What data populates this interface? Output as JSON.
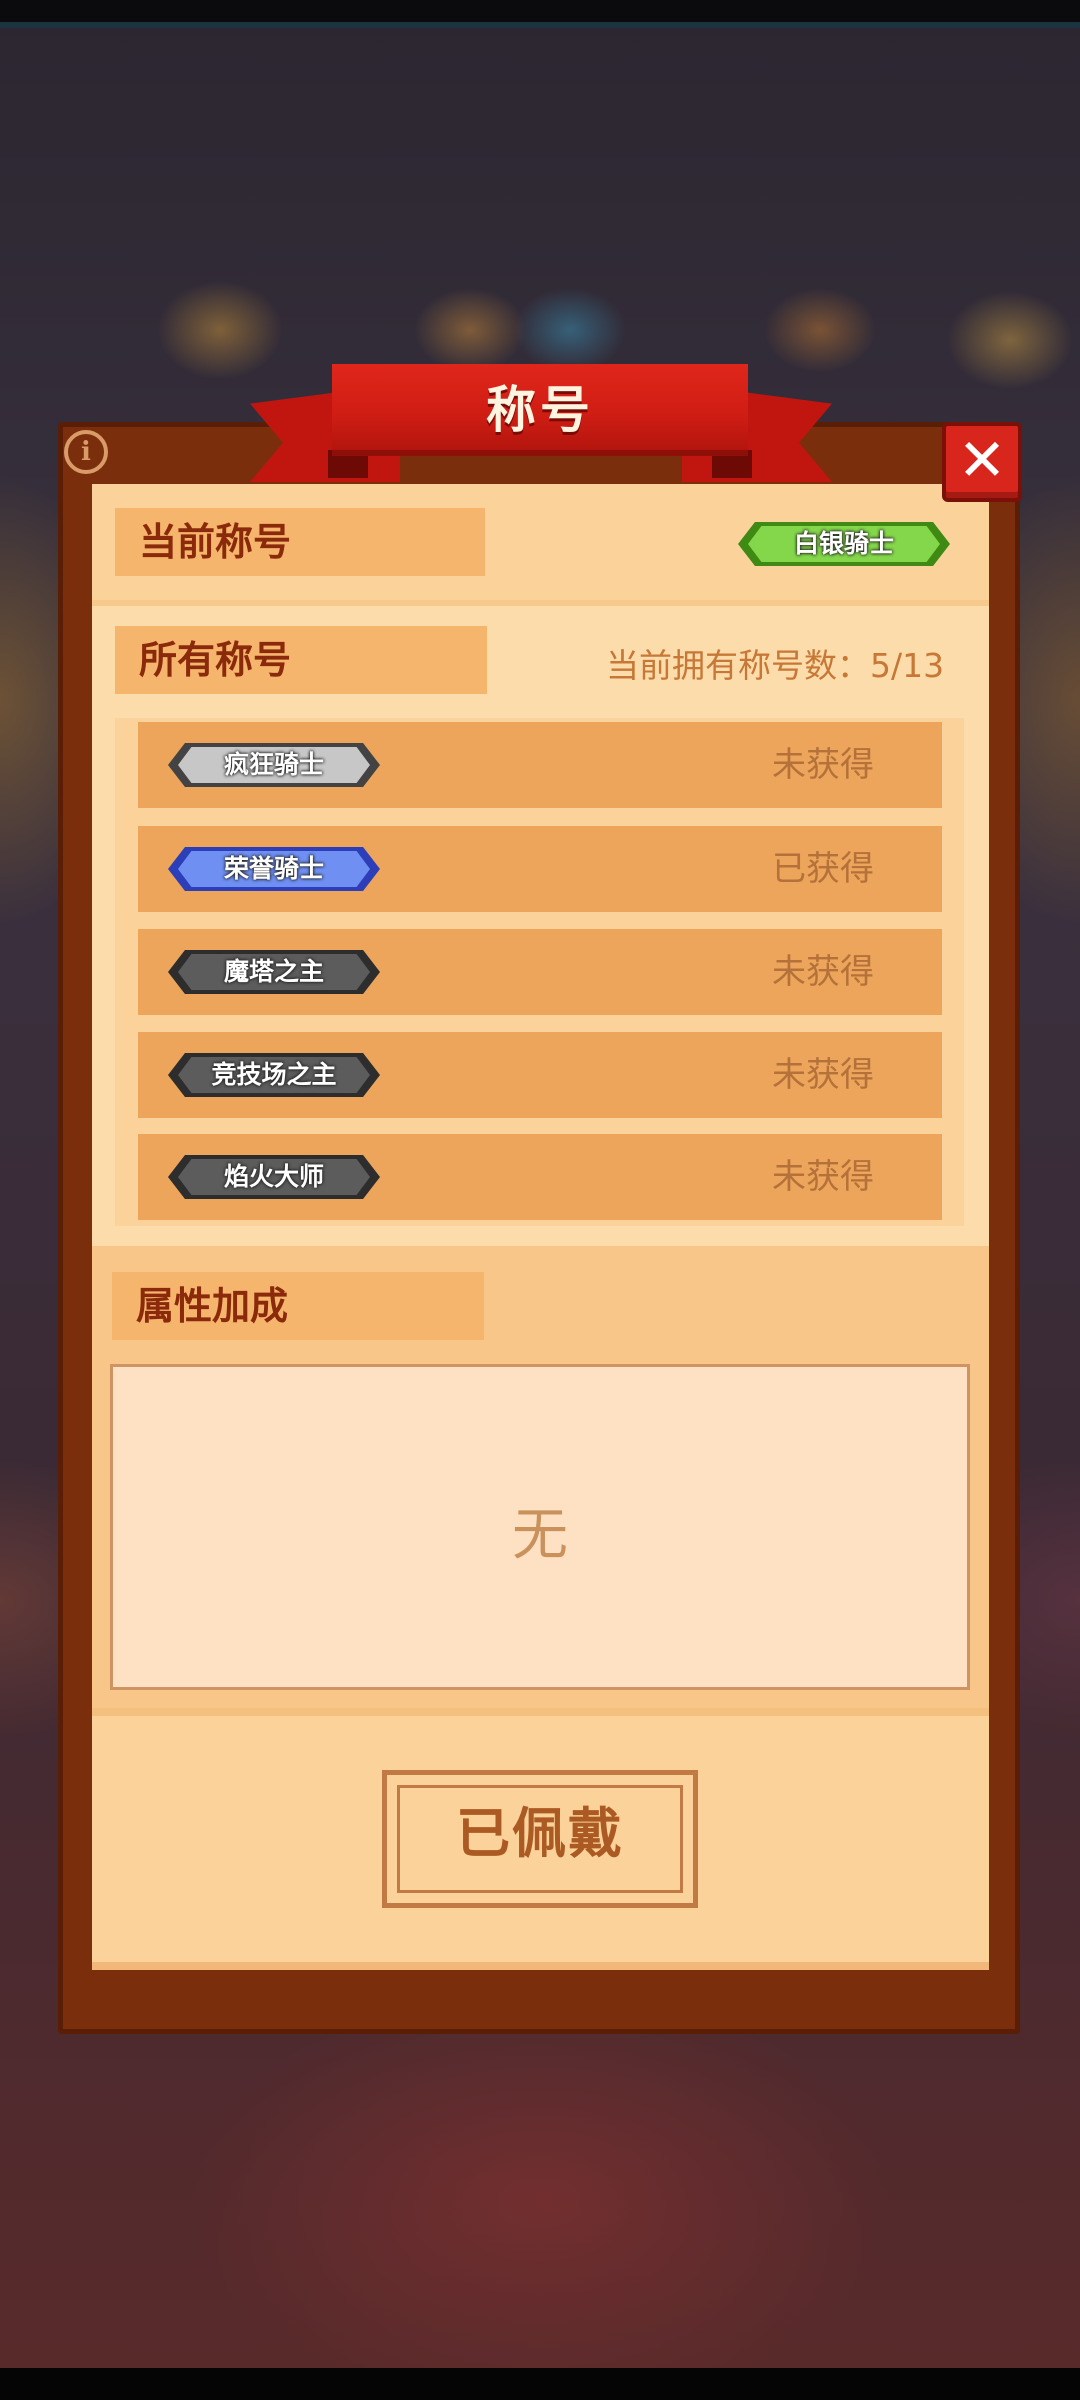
{
  "dialog": {
    "title": "称号",
    "current_title_heading": "当前称号",
    "current_title_badge": "白银骑士",
    "all_titles_heading": "所有称号",
    "owned_count_label": "当前拥有称号数：5/13",
    "titles": [
      {
        "name": "疯狂骑士",
        "status": "未获得",
        "badge_color": "#c7c7c7"
      },
      {
        "name": "荣誉骑士",
        "status": "已获得",
        "badge_color": "#6f8ff2"
      },
      {
        "name": "魔塔之主",
        "status": "未获得",
        "badge_color": "#5c5c5c"
      },
      {
        "name": "竞技场之主",
        "status": "未获得",
        "badge_color": "#5c5c5c"
      },
      {
        "name": "焰火大师",
        "status": "未获得",
        "badge_color": "#5c5c5c"
      }
    ],
    "attribute_heading": "属性加成",
    "attribute_value": "无",
    "equip_button_label": "已佩戴"
  },
  "icons": {
    "info": "info-icon",
    "close": "close-icon"
  },
  "colors": {
    "ribbon": "#d9261d",
    "panel_frame": "#7a2e0c",
    "panel_fill": "#fbd39a",
    "row_fill": "#eca55a",
    "heading_text": "#8a2a0a"
  }
}
